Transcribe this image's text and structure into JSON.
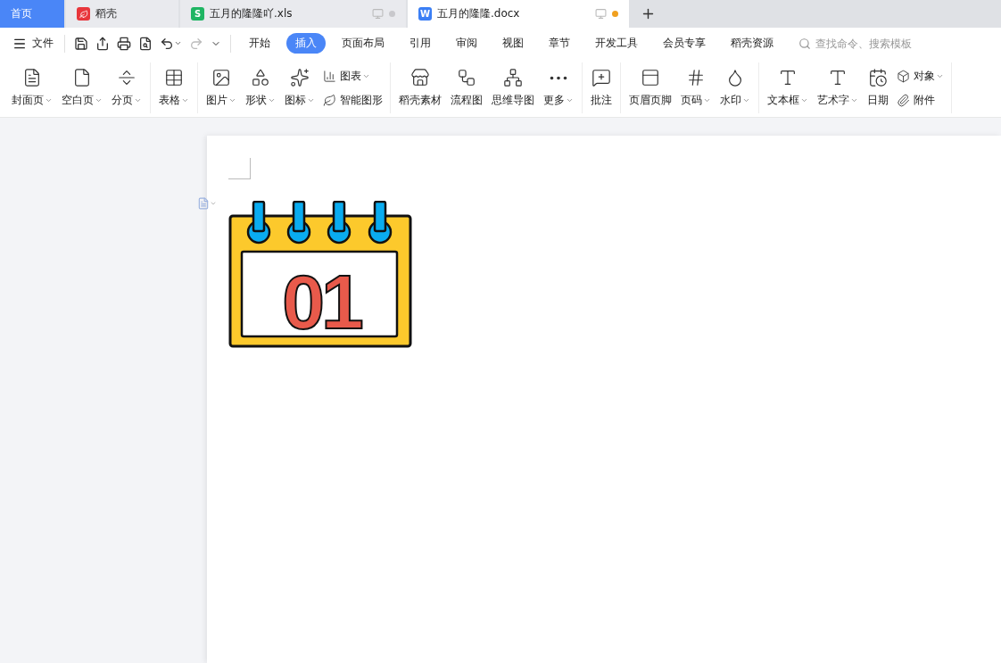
{
  "tabs": [
    {
      "kind": "home",
      "label": "首页",
      "selected": false
    },
    {
      "kind": "app",
      "label": "稻壳",
      "selected": false
    },
    {
      "kind": "sheet",
      "logo_letter": "S",
      "label": "五月的隆隆吖.xls",
      "selected": false,
      "unsaved": false
    },
    {
      "kind": "doc",
      "logo_letter": "W",
      "label": "五月的隆隆.docx",
      "selected": true,
      "unsaved": true
    }
  ],
  "menu": {
    "file_label": "文件",
    "tabs": [
      {
        "label": "开始",
        "selected": false
      },
      {
        "label": "插入",
        "selected": true
      },
      {
        "label": "页面布局",
        "selected": false
      },
      {
        "label": "引用",
        "selected": false
      },
      {
        "label": "审阅",
        "selected": false
      },
      {
        "label": "视图",
        "selected": false
      },
      {
        "label": "章节",
        "selected": false
      },
      {
        "label": "开发工具",
        "selected": false
      },
      {
        "label": "会员专享",
        "selected": false
      },
      {
        "label": "稻壳资源",
        "selected": false
      }
    ],
    "search": {
      "placeholder": "查找命令、搜索模板"
    }
  },
  "ribbon": {
    "groups": [
      {
        "items": [
          {
            "kind": "large",
            "label": "封面页",
            "dropdown": true
          },
          {
            "kind": "large",
            "label": "空白页",
            "dropdown": true
          },
          {
            "kind": "large",
            "label": "分页",
            "dropdown": true
          }
        ]
      },
      {
        "items": [
          {
            "kind": "large",
            "label": "表格",
            "dropdown": true
          }
        ]
      },
      {
        "items": [
          {
            "kind": "large",
            "label": "图片",
            "dropdown": true
          },
          {
            "kind": "large",
            "label": "形状",
            "dropdown": true
          },
          {
            "kind": "large",
            "label": "图标",
            "dropdown": true
          },
          {
            "kind": "stack",
            "items": [
              {
                "label": "图表",
                "dropdown": true
              },
              {
                "label": "智能图形",
                "dropdown": false
              }
            ]
          }
        ]
      },
      {
        "items": [
          {
            "kind": "large",
            "label": "稻壳素材",
            "dropdown": false
          },
          {
            "kind": "large",
            "label": "流程图",
            "dropdown": false
          },
          {
            "kind": "large",
            "label": "思维导图",
            "dropdown": false
          },
          {
            "kind": "large",
            "label": "更多",
            "dropdown": true
          }
        ]
      },
      {
        "items": [
          {
            "kind": "large",
            "label": "批注",
            "dropdown": false
          }
        ]
      },
      {
        "items": [
          {
            "kind": "large",
            "label": "页眉页脚",
            "dropdown": false
          },
          {
            "kind": "large",
            "label": "页码",
            "dropdown": true
          },
          {
            "kind": "large",
            "label": "水印",
            "dropdown": true
          }
        ]
      },
      {
        "items": [
          {
            "kind": "large",
            "label": "文本框",
            "dropdown": true
          },
          {
            "kind": "large",
            "label": "艺术字",
            "dropdown": true
          },
          {
            "kind": "large",
            "label": "日期",
            "dropdown": false
          },
          {
            "kind": "stack",
            "items": [
              {
                "label": "对象",
                "dropdown": true
              },
              {
                "label": "附件",
                "dropdown": false
              }
            ]
          }
        ]
      }
    ]
  },
  "document": {
    "image": {
      "number": "01"
    }
  }
}
